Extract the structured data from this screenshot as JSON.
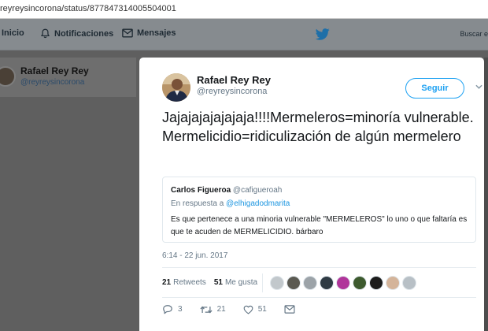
{
  "browser": {
    "url": "reyreysincorona/status/877847314005504001"
  },
  "nav": {
    "items": [
      {
        "label": "Inicio",
        "icon": "home-icon"
      },
      {
        "label": "Notificaciones",
        "icon": "bell-icon"
      },
      {
        "label": "Mensajes",
        "icon": "envelope-icon"
      }
    ],
    "logo_icon": "twitter-bird-icon",
    "search_placeholder": "Buscar e"
  },
  "background_card": {
    "name": "Rafael Rey Rey",
    "handle": "@reyreysincorona"
  },
  "tweet": {
    "author_name": "Rafael Rey Rey",
    "author_handle": "@reyreysincorona",
    "follow_label": "Seguir",
    "text": "Jajajajajajajaja!!!!Mermeleros=minoría vulnerable. Mermelicidio=ridiculización de algún mermelero",
    "quoted": {
      "name": "Carlos Figueroa",
      "handle": "@cafigueroah",
      "reply_prefix": "En respuesta a",
      "reply_to": "@elhigadodmarita",
      "text": "Es que pertenece a una minoria vulnerable \"MERMELEROS\" lo uno o que faltaría es que te acuden de MERMELICIDIO. bárbaro"
    },
    "timestamp": "6:14 - 22 jun. 2017",
    "retweets_count": "21",
    "retweets_label": "Retweets",
    "likes_count": "51",
    "likes_label": "Me gusta",
    "liker_avatar_colors": [
      "#c2c8cc",
      "#5b5a52",
      "#9ca3a8",
      "#2f3b44",
      "#b0359a",
      "#3d5a2e",
      "#1c1c1c",
      "#d4b49a",
      "#b8c0c6"
    ],
    "actions": {
      "reply_count": "3",
      "retweet_count": "21",
      "like_count": "51"
    }
  },
  "colors": {
    "accent": "#1da1f2",
    "overlay": "#5f5f5f",
    "nav": "#868b8f"
  }
}
